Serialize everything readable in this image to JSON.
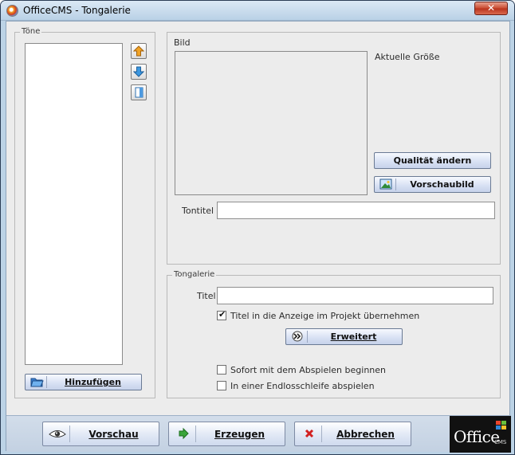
{
  "window": {
    "title": "OfficeCMS - Tongalerie",
    "close_glyph": "✕"
  },
  "toene": {
    "group_label": "Töne",
    "items": [],
    "side_buttons": [
      {
        "name": "move-up-button",
        "icon": "arrow-up-icon"
      },
      {
        "name": "move-down-button",
        "icon": "arrow-down-icon"
      },
      {
        "name": "properties-button",
        "icon": "page-icon"
      }
    ],
    "add_button_label": "Hinzufügen",
    "add_button_mnemonic": "H"
  },
  "bild": {
    "group_label": "Bild",
    "size_label": "Aktuelle Größe",
    "quality_button": "Qualität ändern",
    "preview_image_button": "Vorschaubild",
    "tontitel_label": "Tontitel",
    "tontitel_value": ""
  },
  "tongalerie": {
    "group_label": "Tongalerie",
    "titel_label": "Titel",
    "titel_value": "",
    "checkbox_title_in_display": {
      "label": "Titel in die Anzeige im Projekt übernehmen",
      "checked": true
    },
    "erweitert_button": "Erweitert",
    "checkbox_autoplay": {
      "label": "Sofort mit dem Abspielen beginnen",
      "checked": false
    },
    "checkbox_loop": {
      "label": "In einer Endlosschleife abspielen",
      "checked": false
    }
  },
  "footer": {
    "preview_button": "Vorschau",
    "create_button": "Erzeugen",
    "cancel_button": "Abbrechen",
    "logo_text": "Office",
    "logo_sub": "CMS"
  },
  "colors": {
    "accent": "#c6d2ea",
    "close": "#c94a30",
    "arrow": "#e39a1e",
    "arrow_blue": "#2f86d6"
  }
}
